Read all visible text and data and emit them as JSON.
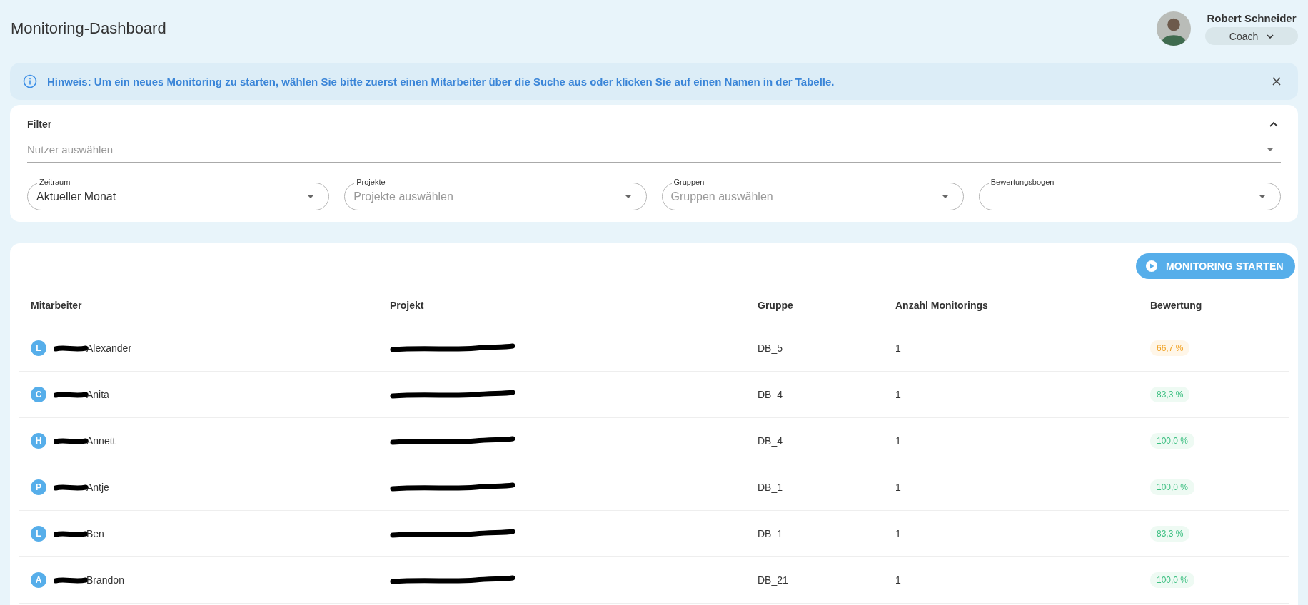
{
  "header": {
    "title": "Monitoring-Dashboard",
    "user": {
      "name": "Robert Schneider",
      "role": "Coach"
    }
  },
  "notice": {
    "text": "Hinweis: Um ein neues Monitoring zu starten, wählen Sie bitte zuerst einen Mitarbeiter über die Suche aus oder klicken Sie auf einen Namen in der Tabelle."
  },
  "filter": {
    "title": "Filter",
    "expanded": true,
    "user_select": {
      "placeholder": "Nutzer auswählen"
    },
    "fields": [
      {
        "label": "Zeitraum",
        "value": "Aktueller Monat"
      },
      {
        "label": "Projekte",
        "placeholder": "Projekte auswählen"
      },
      {
        "label": "Gruppen",
        "placeholder": "Gruppen auswählen"
      },
      {
        "label": "Bewertungsbogen"
      }
    ]
  },
  "table": {
    "action": "MONITORING STARTEN",
    "columns": [
      "Mitarbeiter",
      "Projekt",
      "Gruppe",
      "Anzahl Monitorings",
      "Bewertung"
    ],
    "rows": [
      {
        "initial": "L",
        "name": "Alexander",
        "group": "DB_5",
        "count": "1",
        "rating": "66,7 %",
        "kind": "warning"
      },
      {
        "initial": "C",
        "name": "Anita",
        "group": "DB_4",
        "count": "1",
        "rating": "83,3 %",
        "kind": "success"
      },
      {
        "initial": "H",
        "name": "Annett",
        "group": "DB_4",
        "count": "1",
        "rating": "100,0 %",
        "kind": "success"
      },
      {
        "initial": "P",
        "name": "Antje",
        "group": "DB_1",
        "count": "1",
        "rating": "100,0 %",
        "kind": "success"
      },
      {
        "initial": "L",
        "name": "Ben",
        "group": "DB_1",
        "count": "1",
        "rating": "83,3 %",
        "kind": "success"
      },
      {
        "initial": "A",
        "name": "Brandon",
        "group": "DB_21",
        "count": "1",
        "rating": "100,0 %",
        "kind": "success"
      }
    ]
  }
}
